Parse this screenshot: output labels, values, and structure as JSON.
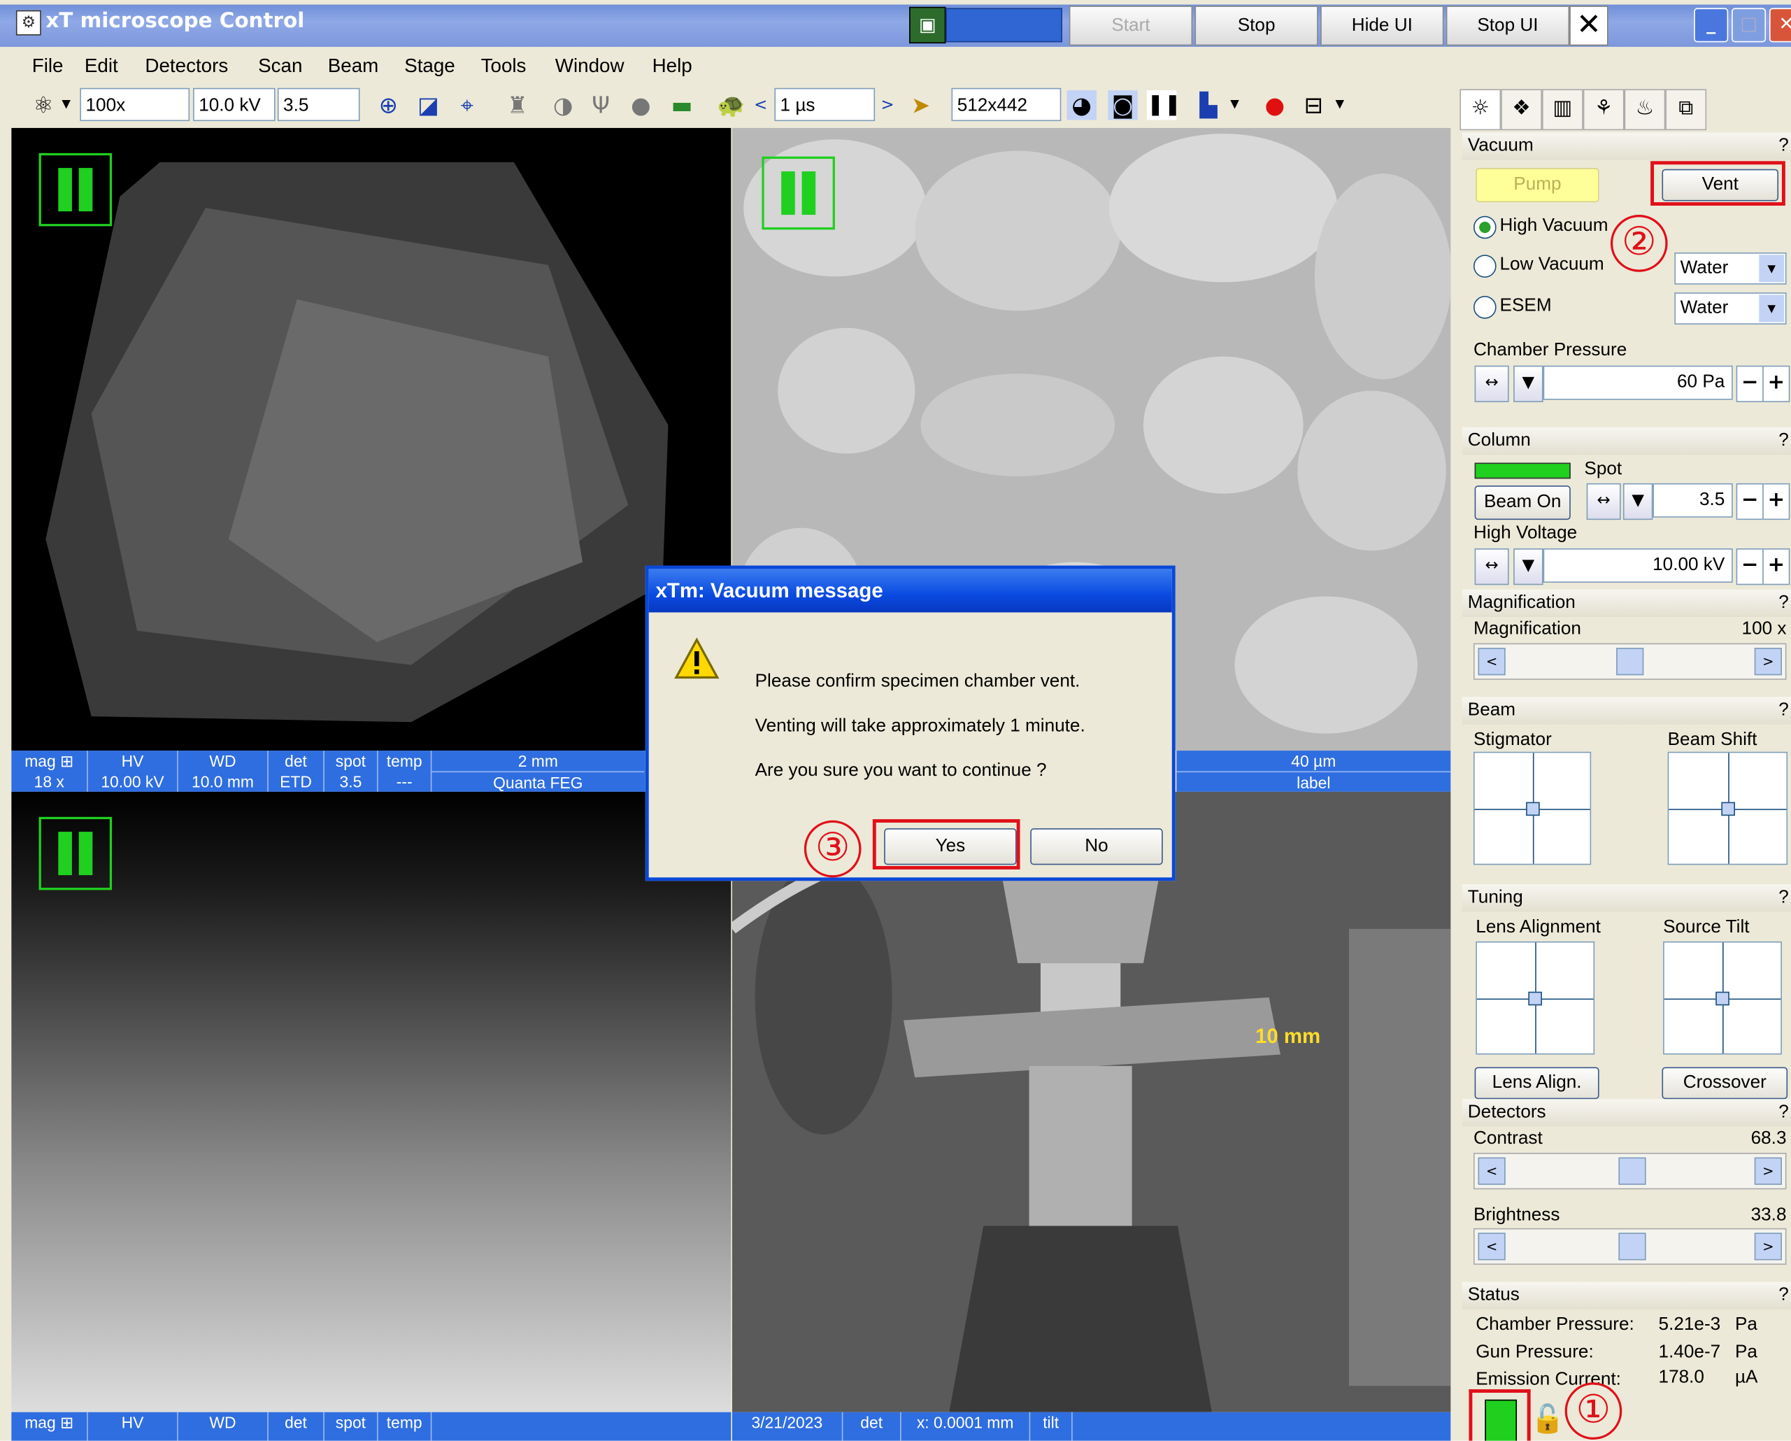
{
  "window": {
    "title": "xT microscope Control",
    "buttons": {
      "start": "Start",
      "stop": "Stop",
      "hide_ui": "Hide UI",
      "stop_ui": "Stop UI"
    }
  },
  "menu": [
    "File",
    "Edit",
    "Detectors",
    "Scan",
    "Beam",
    "Stage",
    "Tools",
    "Window",
    "Help"
  ],
  "toolbar": {
    "magnification": "100x",
    "high_voltage": "10.0 kV",
    "spot": "3.5",
    "dwell_time": "1 µs",
    "resolution": "512x442"
  },
  "quad1": {
    "databar": {
      "mag_h": "mag ⊞",
      "mag": "18 x",
      "hv_h": "HV",
      "hv": "10.00 kV",
      "wd_h": "WD",
      "wd": "10.0 mm",
      "det_h": "det",
      "det": "ETD",
      "spot_h": "spot",
      "spot": "3.5",
      "temp_h": "temp",
      "temp": "---",
      "scale": "2 mm",
      "label": "Quanta FEG"
    }
  },
  "quad2": {
    "databar": {
      "scale": "40 µm",
      "label": "label"
    }
  },
  "quad3": {
    "databar": {
      "mag_h": "mag ⊞",
      "hv_h": "HV",
      "wd_h": "WD",
      "det_h": "det",
      "spot_h": "spot",
      "temp_h": "temp"
    }
  },
  "quad4": {
    "scale_label": "10 mm",
    "databar": {
      "date": "3/21/2023",
      "det_h": "det",
      "x_readout": "x: 0.0001 mm",
      "tilt_h": "tilt"
    }
  },
  "dialog": {
    "title": "xTm: Vacuum message",
    "line1": "Please confirm specimen chamber vent.",
    "line2": "Venting will take approximately 1 minute.",
    "line3": "Are you sure you want to continue ?",
    "yes": "Yes",
    "no": "No"
  },
  "panel": {
    "vacuum": {
      "header": "Vacuum",
      "help": "?",
      "pump": "Pump",
      "vent": "Vent",
      "high_vacuum": "High Vacuum",
      "low_vacuum": "Low Vacuum",
      "esem": "ESEM",
      "low_vacuum_gas": "Water",
      "esem_gas": "Water",
      "chamber_pressure_label": "Chamber Pressure",
      "chamber_pressure": "60 Pa"
    },
    "column": {
      "header": "Column",
      "help": "?",
      "spot_label": "Spot",
      "beam_on": "Beam On",
      "spot": "3.5",
      "hv_label": "High Voltage",
      "hv": "10.00 kV"
    },
    "magnification": {
      "header": "Magnification",
      "help": "?",
      "label": "Magnification",
      "value": "100 x"
    },
    "beam": {
      "header": "Beam",
      "help": "?",
      "stigmator": "Stigmator",
      "beam_shift": "Beam Shift"
    },
    "tuning": {
      "header": "Tuning",
      "help": "?",
      "lens_alignment": "Lens Alignment",
      "source_tilt": "Source Tilt",
      "lens_align_btn": "Lens Align.",
      "crossover_btn": "Crossover"
    },
    "detectors": {
      "header": "Detectors",
      "help": "?",
      "contrast_label": "Contrast",
      "contrast": "68.3",
      "brightness_label": "Brightness",
      "brightness": "33.8"
    },
    "status": {
      "header": "Status",
      "help": "?",
      "chamber_label": "Chamber Pressure:",
      "chamber_value": "5.21e-3",
      "chamber_unit": "Pa",
      "gun_label": "Gun Pressure:",
      "gun_value": "1.40e-7",
      "gun_unit": "Pa",
      "emission_label": "Emission Current:",
      "emission_value": "178.0",
      "emission_unit": "µA"
    }
  },
  "annotations": {
    "step1": "①",
    "step2": "②",
    "step3": "③"
  },
  "colors": {
    "accent_blue": "#2f6ee0",
    "highlight_red": "#e0101a",
    "pause_green": "#1fd01f",
    "pump_yellow": "#ffff99"
  }
}
